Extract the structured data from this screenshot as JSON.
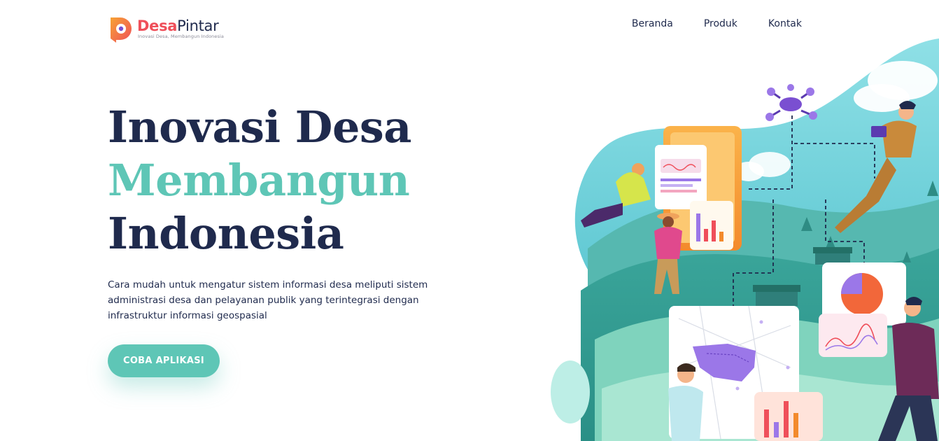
{
  "header": {
    "logo_brand_part1": "Desa",
    "logo_brand_part2": "Pintar",
    "logo_tagline": "Inovasi Desa, Membangun Indonesia",
    "nav": [
      {
        "label": "Beranda"
      },
      {
        "label": "Produk"
      },
      {
        "label": "Kontak"
      }
    ]
  },
  "hero": {
    "title_line1": "Inovasi Desa",
    "title_line2": "Membangun",
    "title_line3": "Indonesia",
    "description": "Cara mudah untuk mengatur sistem informasi desa meliputi sistem administrasi desa dan pelayanan publik yang terintegrasi dengan infrastruktur informasi geospasial",
    "cta_label": "COBA APLIKASI"
  },
  "colors": {
    "primary_dark": "#1f2a4d",
    "accent_teal": "#5ec6b6",
    "logo_red": "#ef4f5a",
    "logo_orange": "#f7a234"
  },
  "illustration": {
    "icon": "village-digital-illustration"
  }
}
